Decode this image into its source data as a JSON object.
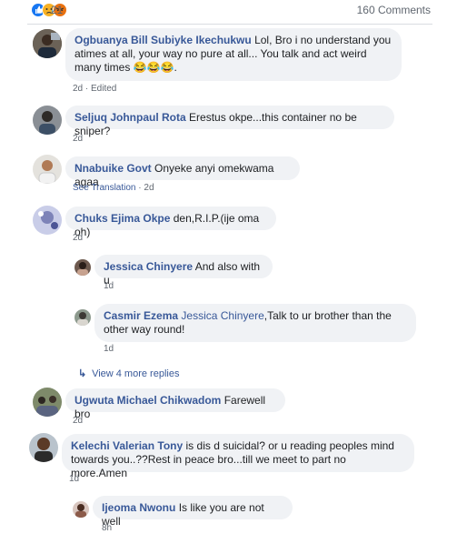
{
  "header": {
    "reaction_count": "21",
    "comments_count": "160 Comments",
    "reactions": [
      "like-icon",
      "sad-icon",
      "angry-icon"
    ]
  },
  "comments": [
    {
      "author": "Ogbuanya Bill Subiyke Ikechukwu",
      "text": "Lol, Bro i no understand you atimes at all, your way no pure at all... You talk and act weird many times 😂😂😂.",
      "time": "2d",
      "edited": "Edited"
    },
    {
      "author": "Seljuq Johnpaul Rota",
      "text": "Erestus okpe...this container no be sniper?",
      "time": "2d"
    },
    {
      "author": "Nnabuike Govt",
      "text": "Onyeke anyi omekwama agaa",
      "translate": "See Translation",
      "time": "2d"
    },
    {
      "author": "Chuks Ejima Okpe",
      "text": "den,R.I.P.(ije oma oh)",
      "time": "2d",
      "replies": [
        {
          "author": "Jessica Chinyere",
          "text": "And also with u",
          "time": "1d"
        },
        {
          "author": "Casmir Ezema",
          "mention": "Jessica Chinyere",
          "text": ",Talk to ur brother than the other way round!",
          "time": "1d"
        }
      ],
      "more_replies": "View 4 more replies"
    },
    {
      "author": "Ugwuta Michael Chikwadom",
      "text": "Farewell bro",
      "time": "2d"
    },
    {
      "author": "Kelechi Valerian Tony",
      "text": "is dis d suicidal? or u reading peoples mind towards you..??Rest in peace bro...till we meet to part no more.Amen",
      "time": "1d",
      "replies": [
        {
          "author": "Ijeoma Nwonu",
          "text": "Is like you are not well",
          "time": "8h"
        }
      ]
    }
  ],
  "colors": {
    "link": "#385898",
    "bubble": "#f0f2f5",
    "meta": "#606770",
    "like": "#1877f2"
  }
}
